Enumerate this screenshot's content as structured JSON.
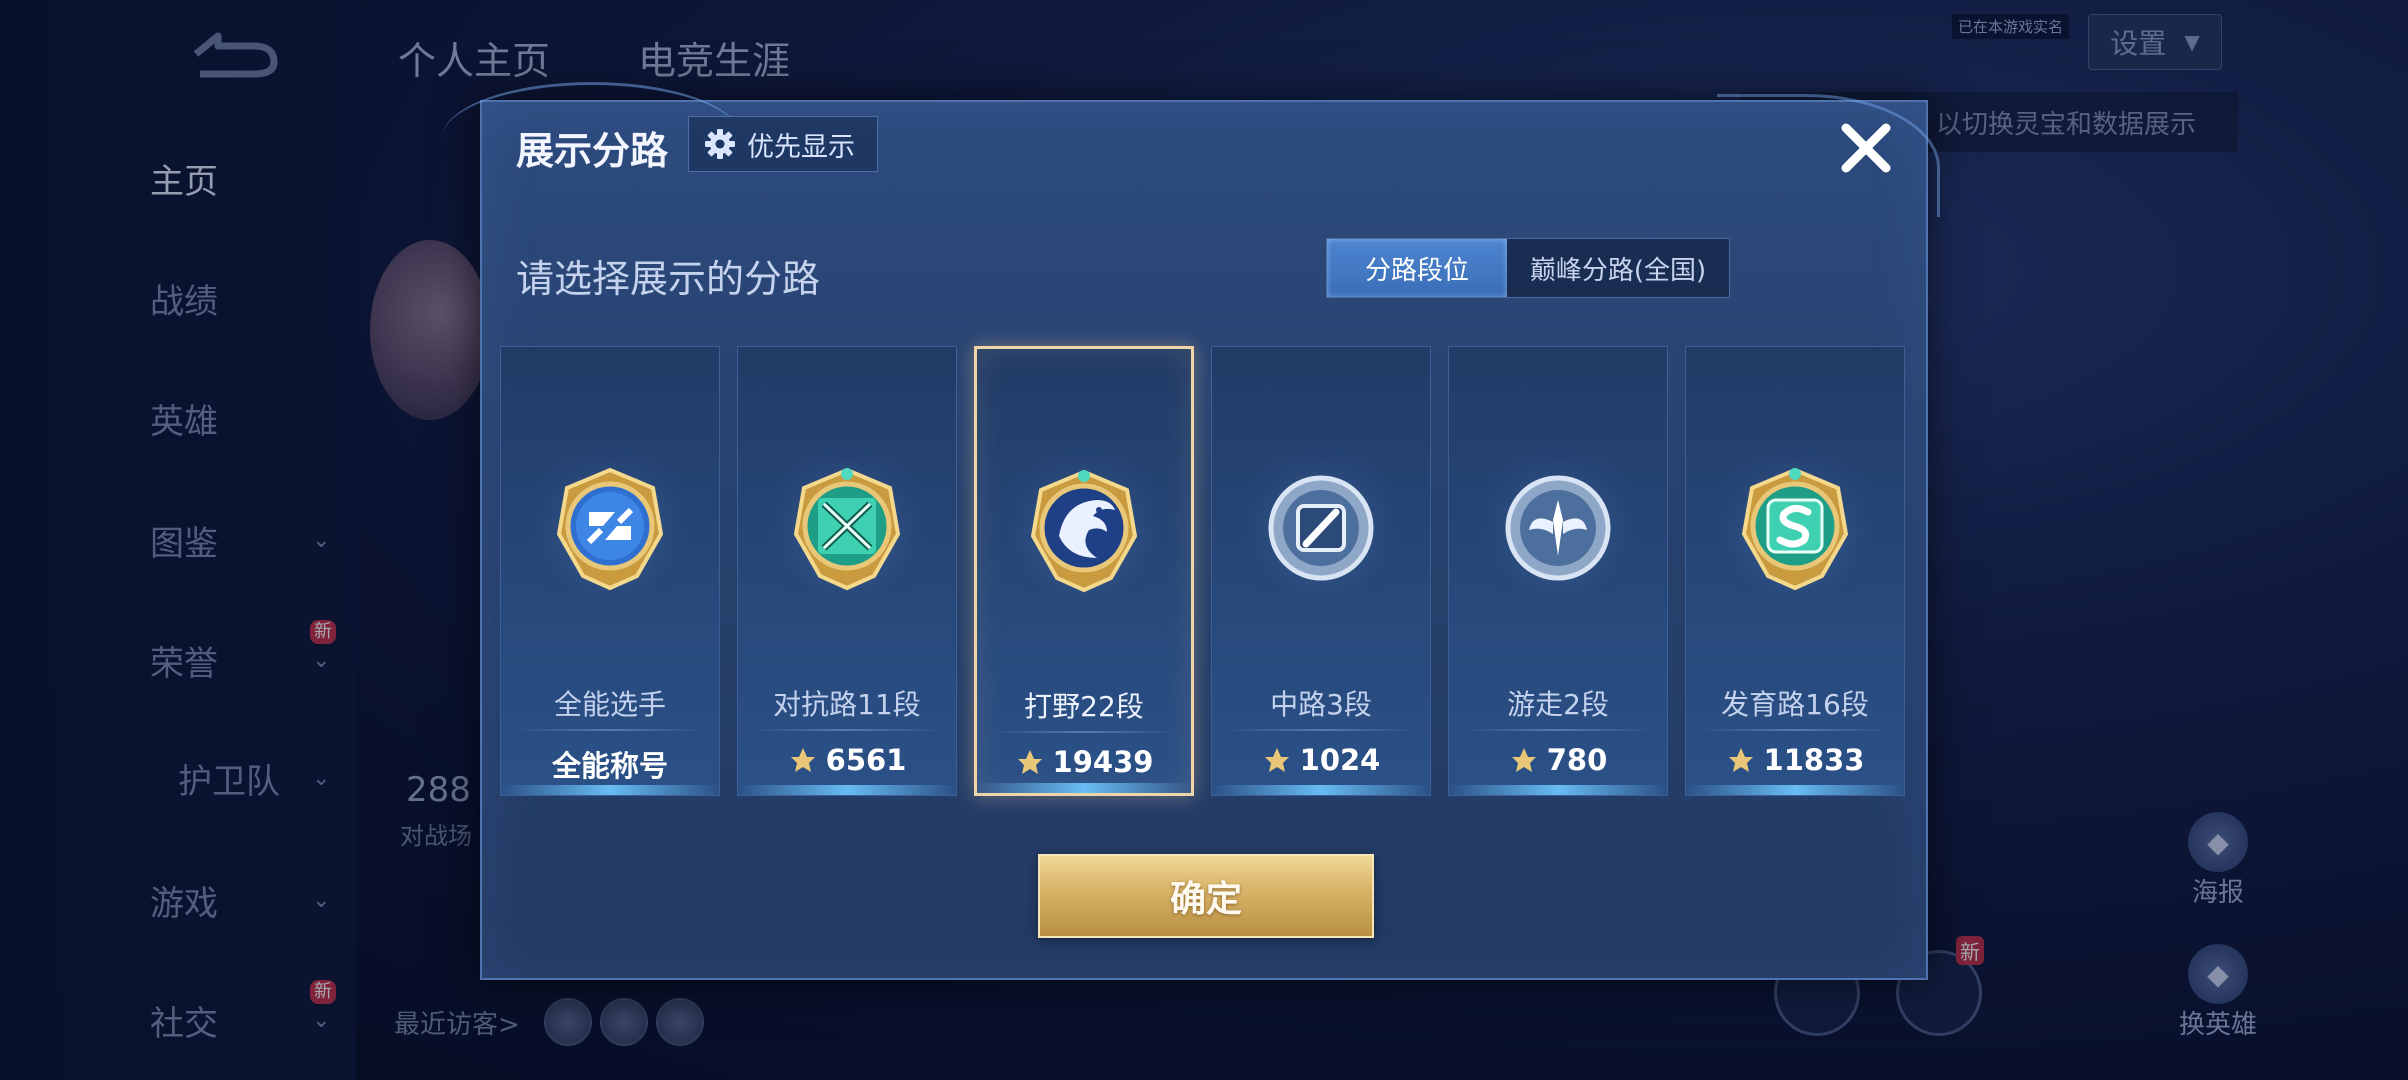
{
  "background": {
    "nav_items": [
      {
        "label": "主页",
        "active": true
      },
      {
        "label": "战绩"
      },
      {
        "label": "英雄"
      },
      {
        "label": "图鉴"
      },
      {
        "label": "荣誉",
        "badge": "新"
      },
      {
        "label": "护卫队"
      },
      {
        "label": "游戏"
      },
      {
        "label": "社交",
        "badge": "新"
      }
    ],
    "top_tabs": [
      "个人主页",
      "电竞生涯"
    ],
    "settings_label": "设置",
    "hint_text": "以切换灵宝和数据展示",
    "tiny_label": "已在本游戏实名",
    "stats_number": "288",
    "stats_label": "对战场",
    "recent_visitors": "最近访客>",
    "right_buttons": [
      "海报",
      "换英雄"
    ],
    "new_mark": "新"
  },
  "modal": {
    "title": "展示分路",
    "priority_label": "优先显示",
    "subtitle": "请选择展示的分路",
    "tabs": [
      {
        "label": "分路段位",
        "active": true
      },
      {
        "label": "巅峰分路(全国)",
        "active": false
      }
    ],
    "lanes": [
      {
        "name": "全能选手",
        "score": "全能称号",
        "emblem": "all-round-emblem",
        "selected": false
      },
      {
        "name": "对抗路11段",
        "score": "6561",
        "emblem": "clash-lane-emblem",
        "selected": false
      },
      {
        "name": "打野22段",
        "score": "19439",
        "emblem": "jungle-emblem",
        "selected": true
      },
      {
        "name": "中路3段",
        "score": "1024",
        "emblem": "mid-lane-emblem",
        "selected": false
      },
      {
        "name": "游走2段",
        "score": "780",
        "emblem": "roam-emblem",
        "selected": false
      },
      {
        "name": "发育路16段",
        "score": "11833",
        "emblem": "farm-lane-emblem",
        "selected": false
      }
    ],
    "confirm_label": "确定",
    "colors": {
      "accent_gold": "#d9b66a",
      "selected_border": "#f0d6a6",
      "tab_active": "#4e86d0"
    }
  }
}
